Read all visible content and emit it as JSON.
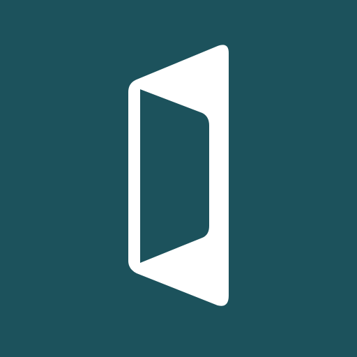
{
  "icon": {
    "name": "open-door-icon",
    "colors": {
      "background": "#1C525C",
      "foreground": "#FFFFFF"
    }
  }
}
